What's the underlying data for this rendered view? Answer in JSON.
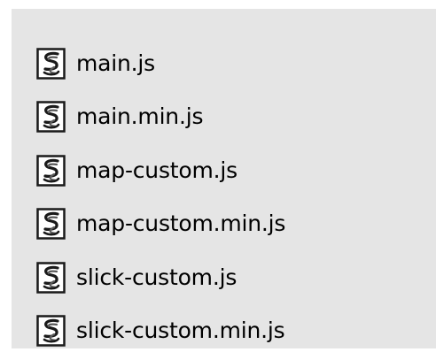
{
  "files": [
    {
      "name": "main.js",
      "icon": "js-script-file-icon"
    },
    {
      "name": "main.min.js",
      "icon": "js-script-file-icon"
    },
    {
      "name": "map-custom.js",
      "icon": "js-script-file-icon"
    },
    {
      "name": "map-custom.min.js",
      "icon": "js-script-file-icon"
    },
    {
      "name": "slick-custom.js",
      "icon": "js-script-file-icon"
    },
    {
      "name": "slick-custom.min.js",
      "icon": "js-script-file-icon"
    }
  ],
  "colors": {
    "panel_background": "#e5e5e5",
    "page_background": "#ffffff",
    "text": "#000000",
    "icon_frame": "#1a1a1a",
    "icon_paper": "#ffffff",
    "icon_scroll": "#5a5a5a"
  }
}
